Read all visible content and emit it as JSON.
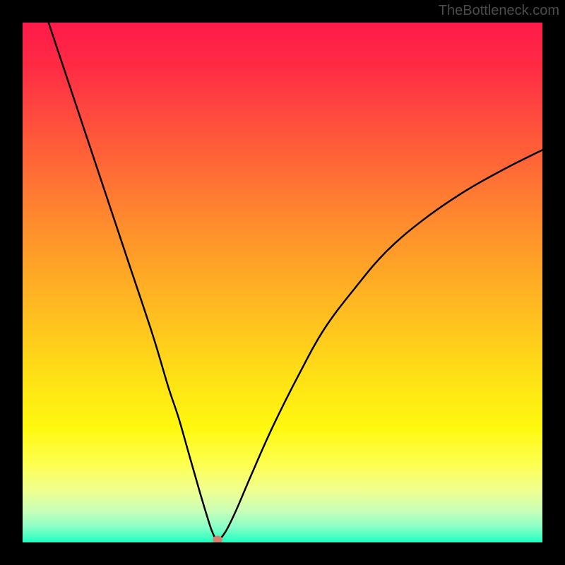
{
  "watermark": "TheBottleneck.com",
  "chart_data": {
    "type": "line",
    "title": "",
    "xlabel": "",
    "ylabel": "",
    "xlim": [
      0,
      100
    ],
    "ylim": [
      0,
      100
    ],
    "series": [
      {
        "name": "bottleneck-curve",
        "x": [
          5,
          10,
          15,
          20,
          25,
          28,
          30,
          32,
          34,
          35.5,
          36.5,
          37.5,
          39,
          41,
          44,
          48,
          53,
          58,
          64,
          70,
          77,
          85,
          93,
          100
        ],
        "y": [
          100,
          85,
          70,
          55,
          40,
          30,
          24,
          17,
          10,
          5,
          2,
          0.5,
          2,
          6,
          13,
          22,
          32,
          41,
          49,
          56,
          62,
          67.5,
          72,
          75.5
        ]
      }
    ],
    "marker": {
      "x": 37.5,
      "y": 0.5,
      "color": "#d88070"
    },
    "gradient_stops": [
      {
        "pos": 0,
        "color": "#ff1a4a"
      },
      {
        "pos": 50,
        "color": "#ffc31e"
      },
      {
        "pos": 78,
        "color": "#fff80f"
      },
      {
        "pos": 100,
        "color": "#1effbf"
      }
    ]
  }
}
